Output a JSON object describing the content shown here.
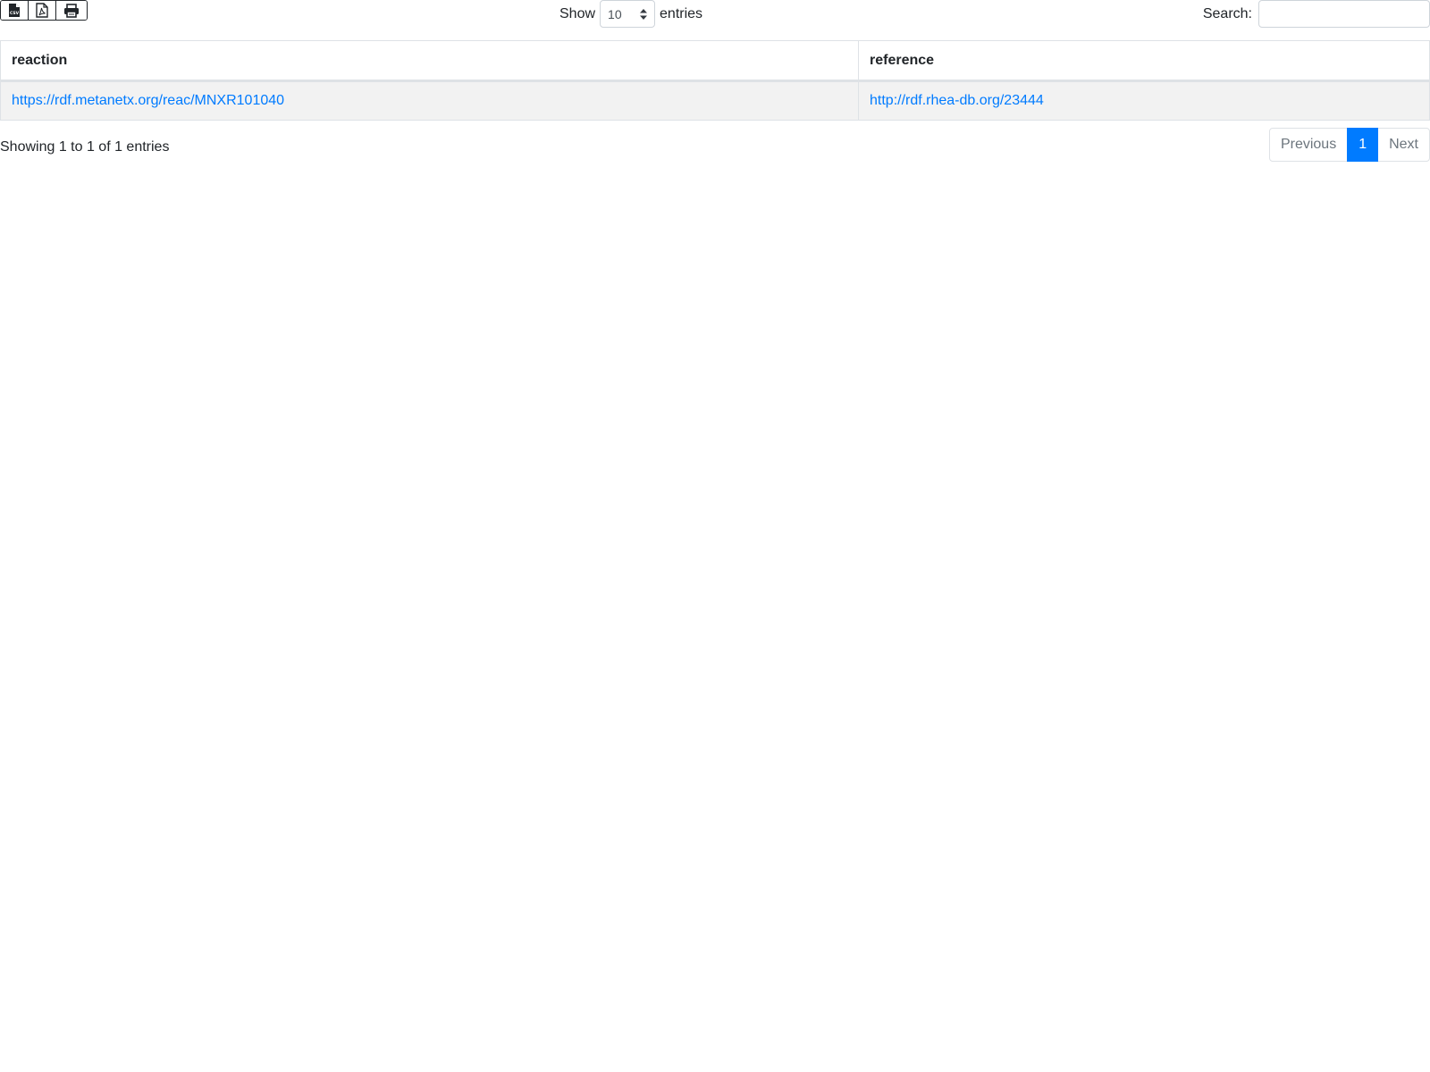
{
  "toolbar": {
    "export_buttons": [
      {
        "icon": "csv-file-icon"
      },
      {
        "icon": "pdf-file-icon"
      },
      {
        "icon": "print-icon"
      }
    ],
    "length": {
      "show_label": "Show",
      "selected": "10",
      "entries_label": "entries"
    },
    "search": {
      "label": "Search:",
      "value": ""
    }
  },
  "table": {
    "columns": [
      "reaction",
      "reference"
    ],
    "rows": [
      [
        "https://rdf.metanetx.org/reac/MNXR101040",
        "http://rdf.rhea-db.org/23444"
      ]
    ]
  },
  "info": "Showing 1 to 1 of 1 entries",
  "pagination": {
    "previous": "Previous",
    "current": "1",
    "next": "Next"
  },
  "colors": {
    "link": "#007bff",
    "active_page": "#007bff",
    "row_bg": "#f2f2f2",
    "border": "#dee2e6"
  }
}
